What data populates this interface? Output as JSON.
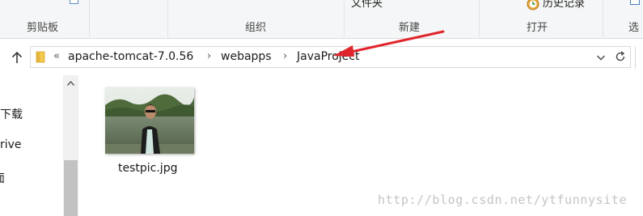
{
  "ribbon": {
    "groups": [
      {
        "label": "剪贴板"
      },
      {
        "label": "组织"
      },
      {
        "label": "新建"
      },
      {
        "label": "打开"
      },
      {
        "label": "选"
      }
    ],
    "new_folder_label": "文件夹",
    "history_label": "历史记录",
    "history_icon": "history-icon",
    "accent_color": "#2f6fbd"
  },
  "address_bar": {
    "overflow_chevron": "«",
    "crumbs": [
      "apache-tomcat-7.0.56",
      "webapps",
      "JavaProject"
    ],
    "separator": "›",
    "folder_icon": "folder-icon"
  },
  "nav_pane": {
    "items": [
      {
        "label": "下载"
      },
      {
        "label": "rive"
      },
      {
        "label": "面"
      }
    ]
  },
  "files": [
    {
      "name": "testpic.jpg",
      "type": "image-thumbnail"
    }
  ],
  "watermark": "http://blog.csdn.net/ytfunnysite",
  "annotation": {
    "arrow_color": "#e0262c"
  }
}
